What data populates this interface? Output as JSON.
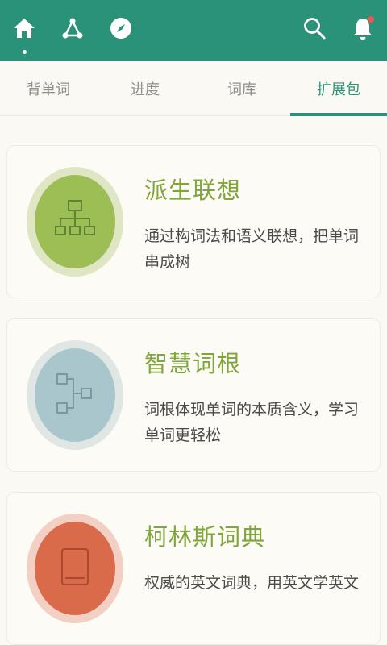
{
  "topbar": {
    "icons": [
      "home-icon",
      "share-icon",
      "compass-icon",
      "search-icon",
      "bell-icon"
    ],
    "colors": {
      "bar": "#2a9278",
      "notify_dot": "#e85a4f"
    }
  },
  "tabs": [
    {
      "label": "背单词"
    },
    {
      "label": "进度"
    },
    {
      "label": "词库"
    },
    {
      "label": "扩展包",
      "active": true
    }
  ],
  "cards": [
    {
      "title": "派生联想",
      "desc": "通过构词法和语义联想，把单词串成树",
      "icon": "hierarchy-tree-icon",
      "colors": {
        "disc": "#9dbd55",
        "ring": "#dfe6c4"
      }
    },
    {
      "title": "智慧词根",
      "desc": "词根体现单词的本质含义，学习单词更轻松",
      "icon": "root-branch-icon",
      "colors": {
        "disc": "#a9c6cc",
        "ring": "#dfe6e4"
      }
    },
    {
      "title": "柯林斯词典",
      "desc": "权威的英文词典，用英文学英文",
      "icon": "book-icon",
      "colors": {
        "disc": "#d96b4a",
        "ring": "#f3d0c4"
      }
    }
  ]
}
